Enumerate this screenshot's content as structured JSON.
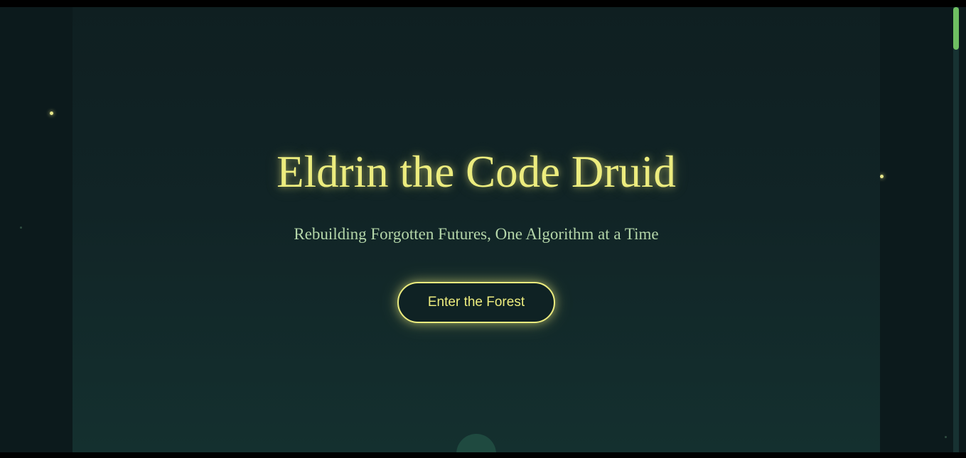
{
  "hero": {
    "title": "Eldrin the Code Druid",
    "subtitle": "Rebuilding Forgotten Futures, One Algorithm at a Time",
    "cta_label": "Enter the Forest"
  },
  "colors": {
    "background": "#0c1a1c",
    "title_glow": "#ecec7e",
    "subtitle": "#b4d6a9",
    "accent_green": "#6fbf62",
    "tree": "#1f4a40"
  },
  "scroll": {
    "position": 0
  }
}
